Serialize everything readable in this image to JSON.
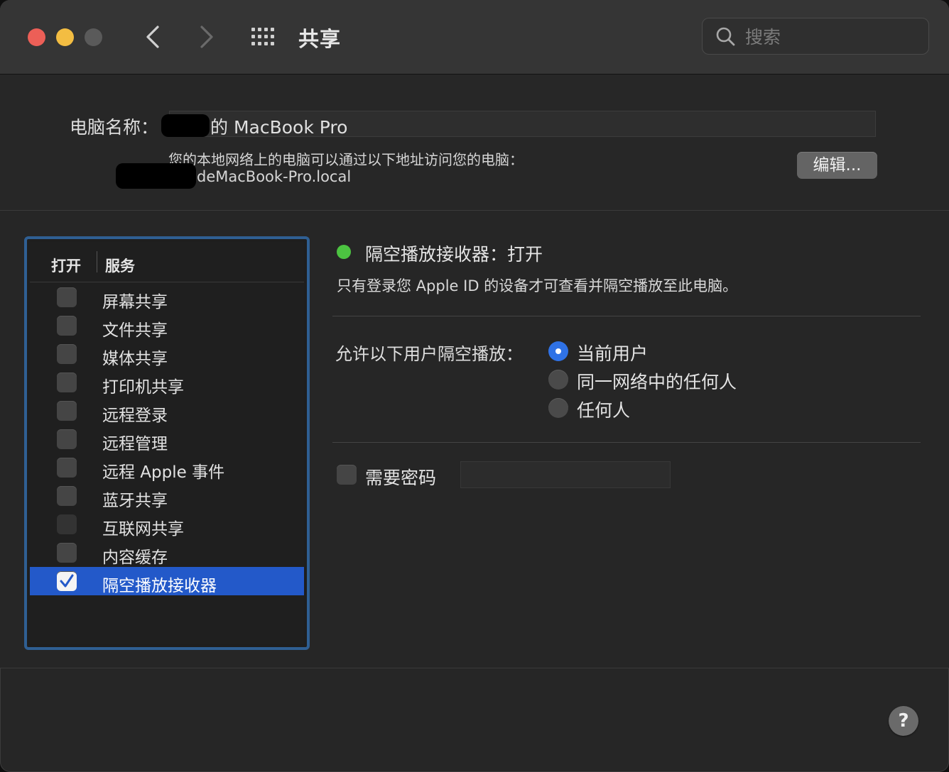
{
  "window": {
    "title": "共享",
    "search_placeholder": "搜索"
  },
  "computer": {
    "name_label": "电脑名称：",
    "name_value": "的 MacBook Pro",
    "address_hint": "您的本地网络上的电脑可以通过以下地址访问您的电脑：",
    "hostname": "deMacBook-Pro.local",
    "edit_button": "编辑..."
  },
  "services": {
    "header_on": "打开",
    "header_service": "服务",
    "items": [
      {
        "label": "屏幕共享",
        "checked": false
      },
      {
        "label": "文件共享",
        "checked": false
      },
      {
        "label": "媒体共享",
        "checked": false
      },
      {
        "label": "打印机共享",
        "checked": false
      },
      {
        "label": "远程登录",
        "checked": false
      },
      {
        "label": "远程管理",
        "checked": false
      },
      {
        "label": "远程 Apple 事件",
        "checked": false
      },
      {
        "label": "蓝牙共享",
        "checked": false
      },
      {
        "label": "互联网共享",
        "checked": false,
        "disabled": true
      },
      {
        "label": "内容缓存",
        "checked": false
      },
      {
        "label": "隔空播放接收器",
        "checked": true,
        "selected": true
      }
    ]
  },
  "detail": {
    "status_text": "隔空播放接收器：打开",
    "status_color": "#4cc341",
    "description": "只有登录您 Apple ID 的设备才可查看并隔空播放至此电脑。",
    "allow_label": "允许以下用户隔空播放：",
    "radio_options": [
      {
        "label": "当前用户",
        "selected": true
      },
      {
        "label": "同一网络中的任何人",
        "selected": false
      },
      {
        "label": "任何人",
        "selected": false
      }
    ],
    "require_password_label": "需要密码",
    "require_password_checked": false
  },
  "help_label": "?",
  "colors": {
    "accent": "#2f72e6",
    "selection": "#2359c9",
    "focus_ring": "#2f5f93"
  }
}
